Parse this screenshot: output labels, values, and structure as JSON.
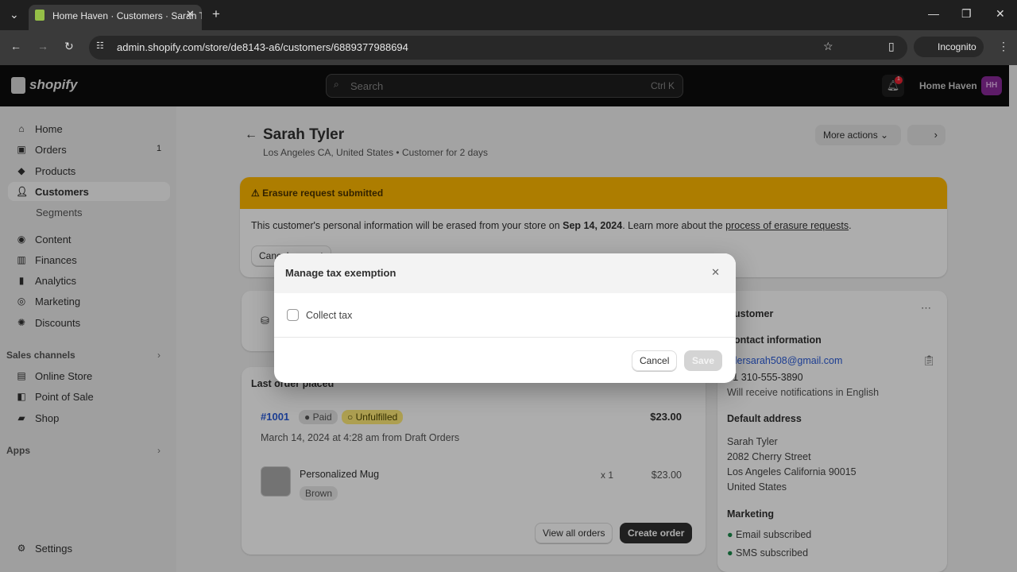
{
  "browser": {
    "tab_title": "Home Haven · Customers · Sarah Tyler",
    "url": "admin.shopify.com/store/de8143-a6/customers/6889377988694",
    "incognito_label": "Incognito"
  },
  "topbar": {
    "logo": "shopify",
    "search_placeholder": "Search",
    "search_shortcut": "Ctrl K",
    "notification_count": "1",
    "store_name": "Home Haven",
    "avatar_initials": "HH",
    "avatar_color": "#8a2a9a"
  },
  "sidebar": {
    "items": [
      {
        "label": "Home",
        "icon": "home-icon"
      },
      {
        "label": "Orders",
        "icon": "orders-icon",
        "badge": "1"
      },
      {
        "label": "Products",
        "icon": "tag-icon"
      },
      {
        "label": "Customers",
        "icon": "person-icon"
      },
      {
        "label": "Segments"
      },
      {
        "label": "Content",
        "icon": "content-icon"
      },
      {
        "label": "Finances",
        "icon": "bank-icon"
      },
      {
        "label": "Analytics",
        "icon": "chart-icon"
      },
      {
        "label": "Marketing",
        "icon": "target-icon"
      },
      {
        "label": "Discounts",
        "icon": "discount-icon"
      }
    ],
    "sales_channels_label": "Sales channels",
    "channels": [
      {
        "label": "Online Store"
      },
      {
        "label": "Point of Sale"
      },
      {
        "label": "Shop"
      }
    ],
    "apps_label": "Apps",
    "settings_label": "Settings"
  },
  "customer": {
    "name": "Sarah Tyler",
    "subtitle": "Los Angeles CA, United States • Customer for 2 days",
    "more_actions": "More actions"
  },
  "banner": {
    "title": "Erasure request submitted",
    "text_before": "This customer's personal information will be erased from your store on ",
    "date": "Sep 14, 2024",
    "text_after": ". Learn more about the ",
    "link": "process of erasure requests",
    "text_end": ".",
    "button": "Cancel request",
    "color": "#ffb800"
  },
  "order": {
    "section_label": "Last order placed",
    "number": "#1001",
    "payment": "Paid",
    "fulfillment": "Unfulfilled",
    "total": "$23.00",
    "meta": "March 14, 2024 at 4:28 am from Draft Orders",
    "item_name": "Personalized Mug",
    "variant": "Brown",
    "qty": "x 1",
    "item_price": "$23.00",
    "view_all": "View all orders",
    "create": "Create order"
  },
  "side_card": {
    "title": "Customer",
    "contact_label": "Contact information",
    "email": "tylersarah508@gmail.com",
    "phone": "+1 310-555-3890",
    "notify": "Will receive notifications in English",
    "address_label": "Default address",
    "address": [
      "Sarah Tyler",
      "2082 Cherry Street",
      "Los Angeles California 90015",
      "United States"
    ],
    "marketing_label": "Marketing",
    "marketing": [
      "Email subscribed",
      "SMS subscribed"
    ]
  },
  "modal": {
    "title": "Manage tax exemption",
    "checkbox_label": "Collect tax",
    "checked": false,
    "cancel": "Cancel",
    "save": "Save"
  }
}
